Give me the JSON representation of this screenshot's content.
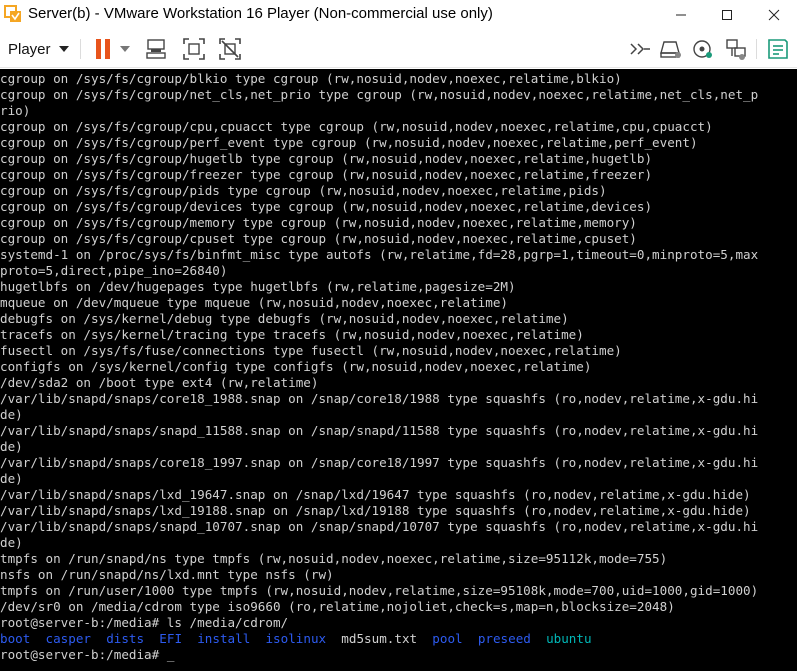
{
  "window": {
    "title": "Server(b) - VMware Workstation 16 Player (Non-commercial use only)",
    "controls": [
      "minimize",
      "maximize",
      "close"
    ]
  },
  "toolbar": {
    "player_label": "Player",
    "icons": [
      "pause-icon",
      "send-ctrl-alt-del-icon",
      "fit-guest-icon",
      "unity-icon",
      "enter-fullscreen-icon",
      "removable-devices-icon",
      "cd-rom-icon",
      "network-adapter-icon",
      "notes-icon"
    ]
  },
  "terminal": {
    "lines": [
      "cgroup on /sys/fs/cgroup/blkio type cgroup (rw,nosuid,nodev,noexec,relatime,blkio)",
      "cgroup on /sys/fs/cgroup/net_cls,net_prio type cgroup (rw,nosuid,nodev,noexec,relatime,net_cls,net_p",
      "rio)",
      "cgroup on /sys/fs/cgroup/cpu,cpuacct type cgroup (rw,nosuid,nodev,noexec,relatime,cpu,cpuacct)",
      "cgroup on /sys/fs/cgroup/perf_event type cgroup (rw,nosuid,nodev,noexec,relatime,perf_event)",
      "cgroup on /sys/fs/cgroup/hugetlb type cgroup (rw,nosuid,nodev,noexec,relatime,hugetlb)",
      "cgroup on /sys/fs/cgroup/freezer type cgroup (rw,nosuid,nodev,noexec,relatime,freezer)",
      "cgroup on /sys/fs/cgroup/pids type cgroup (rw,nosuid,nodev,noexec,relatime,pids)",
      "cgroup on /sys/fs/cgroup/devices type cgroup (rw,nosuid,nodev,noexec,relatime,devices)",
      "cgroup on /sys/fs/cgroup/memory type cgroup (rw,nosuid,nodev,noexec,relatime,memory)",
      "cgroup on /sys/fs/cgroup/cpuset type cgroup (rw,nosuid,nodev,noexec,relatime,cpuset)",
      "systemd-1 on /proc/sys/fs/binfmt_misc type autofs (rw,relatime,fd=28,pgrp=1,timeout=0,minproto=5,max",
      "proto=5,direct,pipe_ino=26840)",
      "hugetlbfs on /dev/hugepages type hugetlbfs (rw,relatime,pagesize=2M)",
      "mqueue on /dev/mqueue type mqueue (rw,nosuid,nodev,noexec,relatime)",
      "debugfs on /sys/kernel/debug type debugfs (rw,nosuid,nodev,noexec,relatime)",
      "tracefs on /sys/kernel/tracing type tracefs (rw,nosuid,nodev,noexec,relatime)",
      "fusectl on /sys/fs/fuse/connections type fusectl (rw,nosuid,nodev,noexec,relatime)",
      "configfs on /sys/kernel/config type configfs (rw,nosuid,nodev,noexec,relatime)",
      "/dev/sda2 on /boot type ext4 (rw,relatime)",
      "/var/lib/snapd/snaps/core18_1988.snap on /snap/core18/1988 type squashfs (ro,nodev,relatime,x-gdu.hi",
      "de)",
      "/var/lib/snapd/snaps/snapd_11588.snap on /snap/snapd/11588 type squashfs (ro,nodev,relatime,x-gdu.hi",
      "de)",
      "/var/lib/snapd/snaps/core18_1997.snap on /snap/core18/1997 type squashfs (ro,nodev,relatime,x-gdu.hi",
      "de)",
      "/var/lib/snapd/snaps/lxd_19647.snap on /snap/lxd/19647 type squashfs (ro,nodev,relatime,x-gdu.hide)",
      "/var/lib/snapd/snaps/lxd_19188.snap on /snap/lxd/19188 type squashfs (ro,nodev,relatime,x-gdu.hide)",
      "/var/lib/snapd/snaps/snapd_10707.snap on /snap/snapd/10707 type squashfs (ro,nodev,relatime,x-gdu.hi",
      "de)",
      "tmpfs on /run/snapd/ns type tmpfs (rw,nosuid,nodev,noexec,relatime,size=95112k,mode=755)",
      "nsfs on /run/snapd/ns/lxd.mnt type nsfs (rw)",
      "tmpfs on /run/user/1000 type tmpfs (rw,nosuid,nodev,relatime,size=95108k,mode=700,uid=1000,gid=1000)",
      "/dev/sr0 on /media/cdrom type iso9660 (ro,relatime,nojoliet,check=s,map=n,blocksize=2048)",
      "root@server-b:/media# ls /media/cdrom/"
    ],
    "ls_output": [
      {
        "name": "boot",
        "kind": "dir"
      },
      {
        "name": "casper",
        "kind": "dir"
      },
      {
        "name": "dists",
        "kind": "dir"
      },
      {
        "name": "EFI",
        "kind": "dir"
      },
      {
        "name": "install",
        "kind": "dir"
      },
      {
        "name": "isolinux",
        "kind": "dir"
      },
      {
        "name": "md5sum.txt",
        "kind": "file"
      },
      {
        "name": "pool",
        "kind": "dir"
      },
      {
        "name": "preseed",
        "kind": "dir"
      },
      {
        "name": "ubuntu",
        "kind": "link"
      }
    ],
    "prompt": "root@server-b:/media# ",
    "cursor": "_"
  },
  "colors": {
    "terminal_bg": "#000000",
    "terminal_fg": "#d0d0d0",
    "dir": "#2d5bf0",
    "link": "#00b7b7",
    "pause_accent": "#e8541c",
    "notes_accent": "#1a9a7a"
  }
}
